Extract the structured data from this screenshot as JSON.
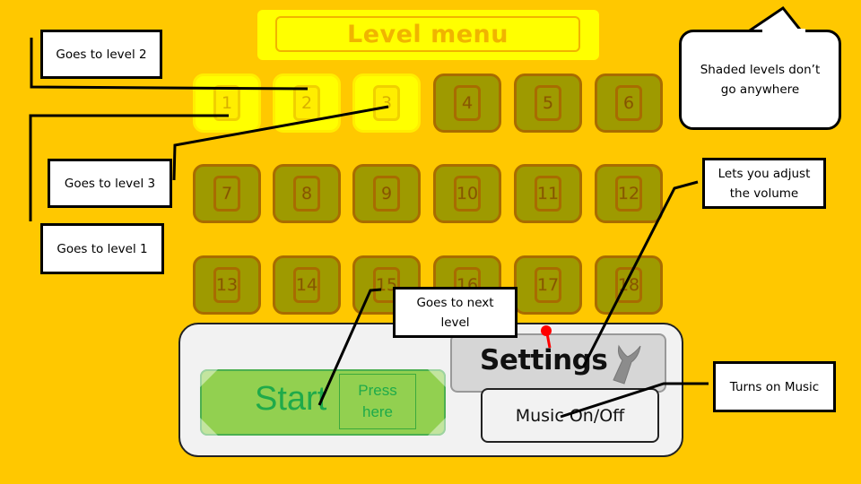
{
  "title": "Level menu",
  "levels": [
    {
      "label": "1",
      "state": "unlocked"
    },
    {
      "label": "2",
      "state": "unlocked"
    },
    {
      "label": "3",
      "state": "unlocked"
    },
    {
      "label": "4",
      "state": "locked"
    },
    {
      "label": "5",
      "state": "locked"
    },
    {
      "label": "6",
      "state": "locked"
    },
    {
      "label": "7",
      "state": "locked"
    },
    {
      "label": "8",
      "state": "locked"
    },
    {
      "label": "9",
      "state": "locked"
    },
    {
      "label": "10",
      "state": "locked"
    },
    {
      "label": "11",
      "state": "locked"
    },
    {
      "label": "12",
      "state": "locked"
    },
    {
      "label": "13",
      "state": "locked"
    },
    {
      "label": "14",
      "state": "locked"
    },
    {
      "label": "15",
      "state": "locked"
    },
    {
      "label": "16",
      "state": "locked"
    },
    {
      "label": "17",
      "state": "locked"
    },
    {
      "label": "18",
      "state": "locked"
    }
  ],
  "panel": {
    "start_label": "Start",
    "press_line1": "Press",
    "press_line2": "here",
    "settings_label": "Settings",
    "music_label": "Music On/Off",
    "settings_icon": "wrench-icon",
    "pin_icon": "red-pin-icon"
  },
  "annotations": {
    "goes_to_level_2": "Goes to level 2",
    "goes_to_level_3": "Goes to level 3",
    "goes_to_level_1": "Goes to level 1",
    "shaded_levels": "Shaded levels don’t go anywhere",
    "adjust_volume": "Lets you adjust the volume",
    "next_level_line1": "Goes to next",
    "next_level_line2": "level",
    "turns_on_music": "Turns on Music"
  },
  "colors": {
    "background": "#ffc800",
    "unlocked_tile": "#ffff00",
    "locked_tile": "#9e9a00",
    "start_green": "#92d050"
  }
}
